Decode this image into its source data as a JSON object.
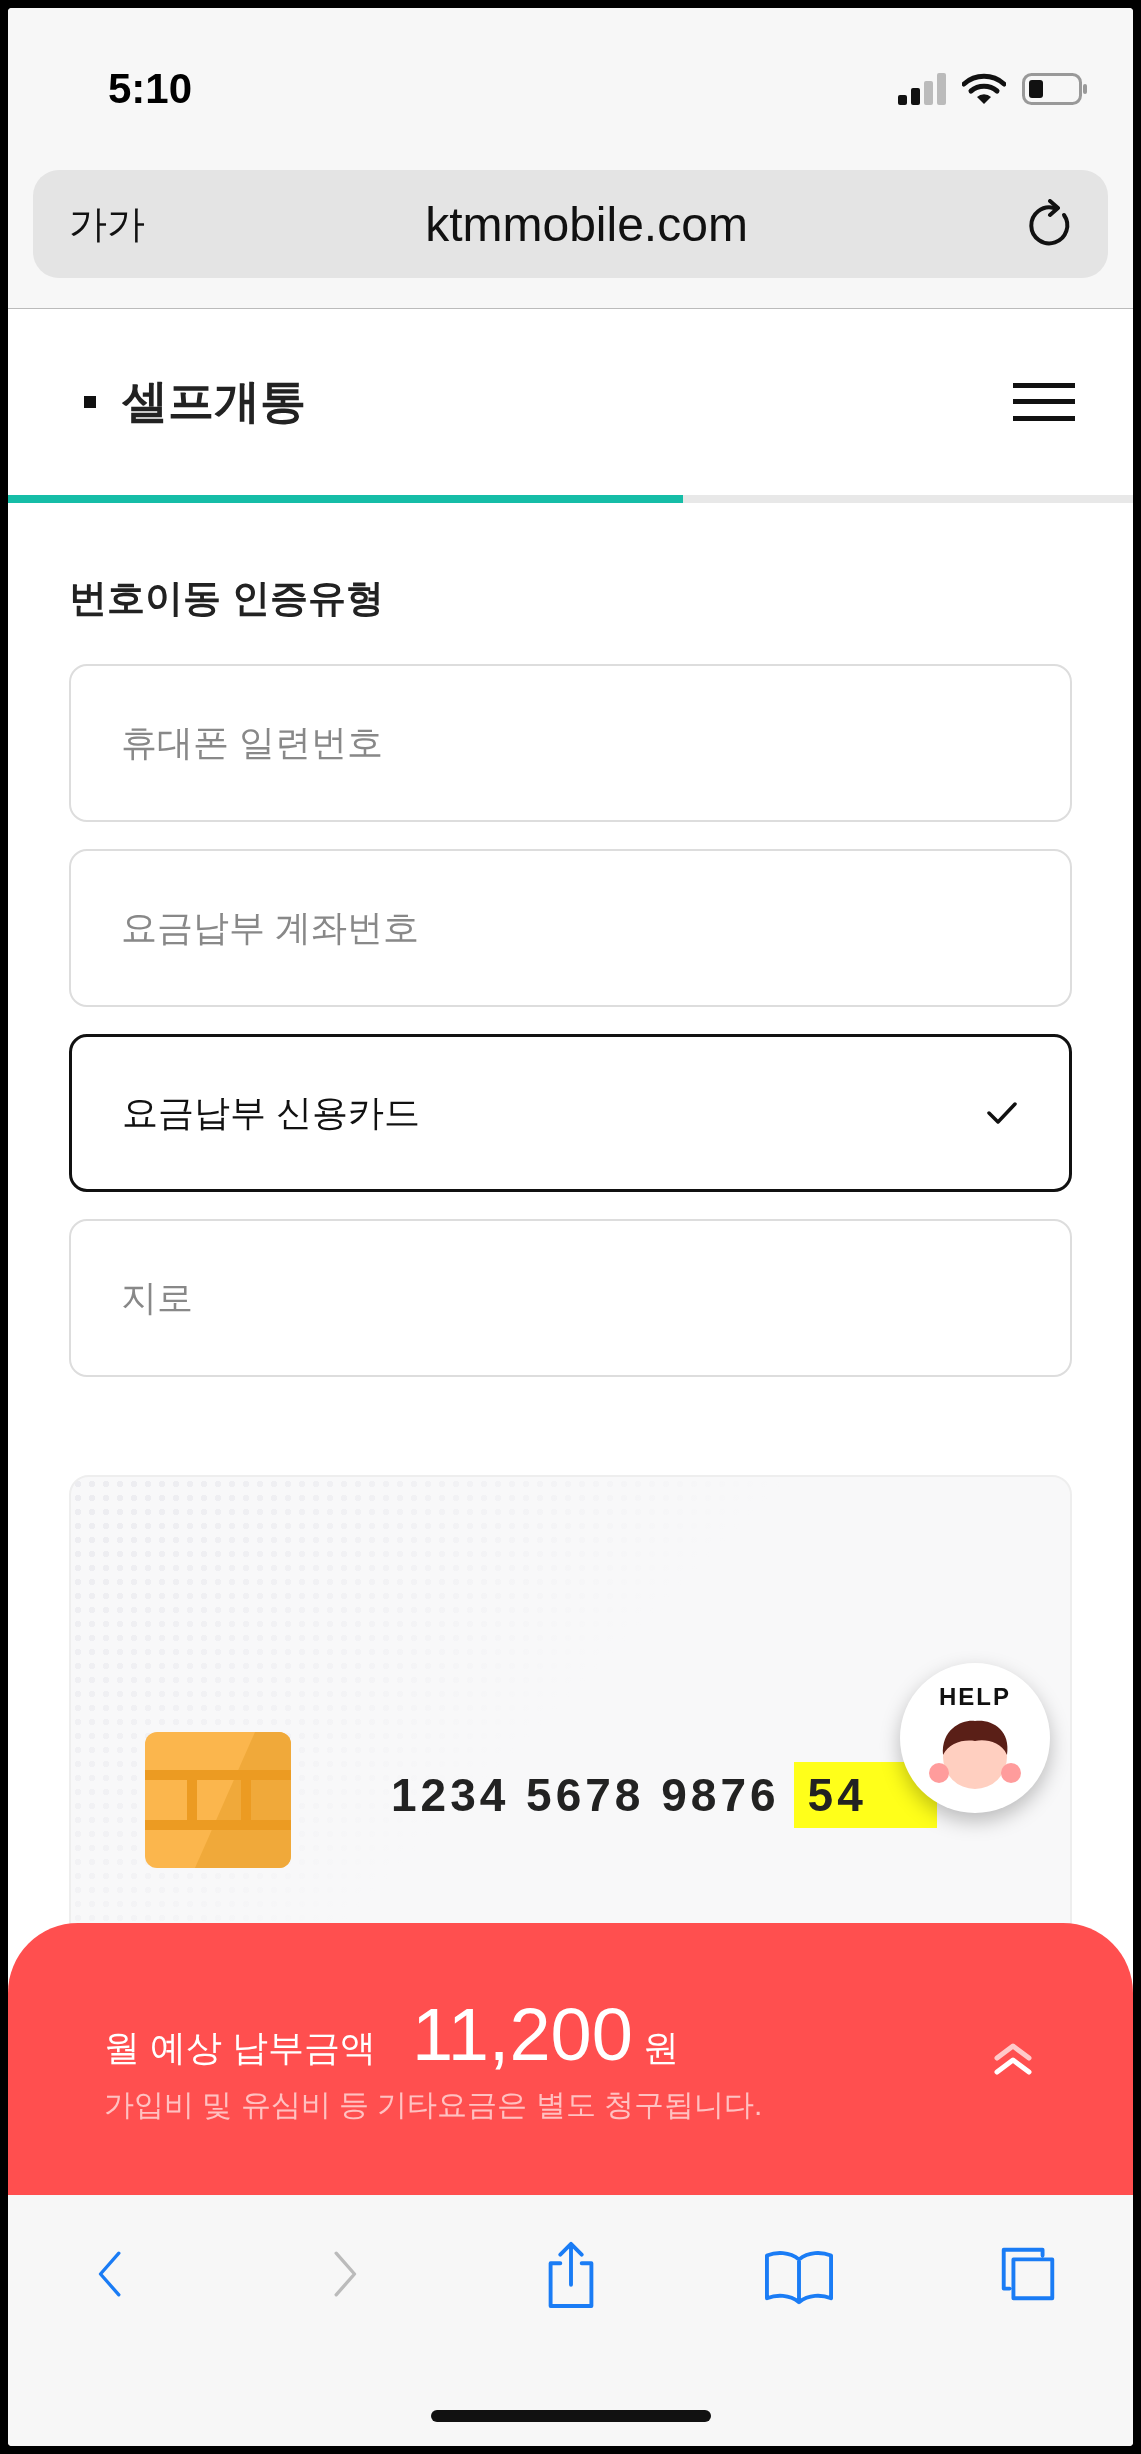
{
  "status_bar": {
    "time": "5:10"
  },
  "browser": {
    "text_size_button": "가가",
    "url": "ktmmobile.com"
  },
  "header": {
    "title": "셀프개통"
  },
  "progress": {
    "level": 0.6
  },
  "section": {
    "title": "번호이동 인증유형",
    "options": [
      {
        "label": "휴대폰 일련번호",
        "selected": false
      },
      {
        "label": "요금납부 계좌번호",
        "selected": false
      },
      {
        "label": "요금납부 신용카드",
        "selected": true
      },
      {
        "label": "지로",
        "selected": false
      }
    ]
  },
  "card": {
    "number": "1234 5678 9876",
    "highlighted_digits": "54"
  },
  "help_button": {
    "label": "HELP"
  },
  "payment_bar": {
    "label": "월 예상 납부금액",
    "amount": "11,200",
    "unit": "원",
    "note": "가입비 및 유심비 등 기타요금은 별도 청구됩니다."
  },
  "toolbar": {
    "items": [
      {
        "kind": "back",
        "disabled": false
      },
      {
        "kind": "forward",
        "disabled": true
      },
      {
        "kind": "share",
        "disabled": false
      },
      {
        "kind": "bookmarks",
        "disabled": false
      },
      {
        "kind": "tabs",
        "disabled": false
      }
    ]
  }
}
